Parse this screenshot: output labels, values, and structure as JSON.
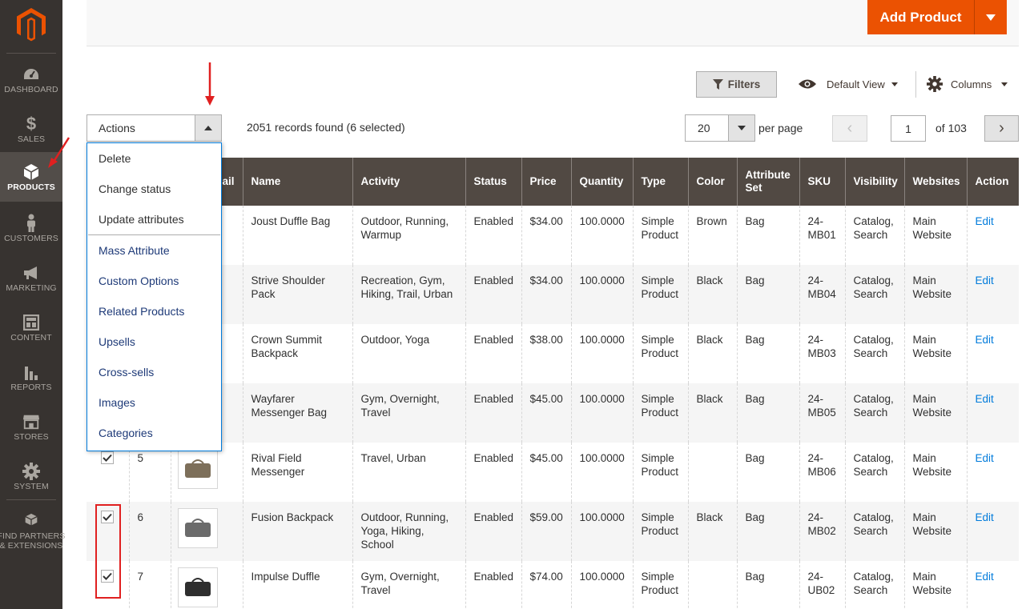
{
  "colors": {
    "sidebar_bg": "#373330",
    "sidebar_active": "#524d49",
    "accent": "#eb5202",
    "header_bg": "#514943",
    "link": "#007bdb",
    "annotation": "#e02020"
  },
  "sidebar": {
    "items": [
      {
        "label": "DASHBOARD",
        "icon": "dashboard-icon"
      },
      {
        "label": "SALES",
        "icon": "dollar-icon"
      },
      {
        "label": "PRODUCTS",
        "icon": "cube-icon",
        "active": true
      },
      {
        "label": "CUSTOMERS",
        "icon": "person-icon"
      },
      {
        "label": "MARKETING",
        "icon": "megaphone-icon"
      },
      {
        "label": "CONTENT",
        "icon": "layout-icon"
      },
      {
        "label": "REPORTS",
        "icon": "bar-chart-icon"
      },
      {
        "label": "STORES",
        "icon": "store-icon"
      },
      {
        "label": "SYSTEM",
        "icon": "gear-icon"
      },
      {
        "label_line1": "FIND PARTNERS",
        "label_line2": "& EXTENSIONS",
        "icon": "boxes-icon"
      }
    ]
  },
  "header": {
    "add_product_label": "Add Product"
  },
  "toolbar": {
    "filters_label": "Filters",
    "view_label": "Default View",
    "columns_label": "Columns"
  },
  "actions": {
    "label": "Actions",
    "records_text": "2051 records found (6 selected)",
    "menu_basic": [
      "Delete",
      "Change status",
      "Update attributes"
    ],
    "menu_extended": [
      "Mass Attribute",
      "Custom Options",
      "Related Products",
      "Upsells",
      "Cross-sells",
      "Images",
      "Categories"
    ]
  },
  "pager": {
    "per_page_value": "20",
    "per_page_label": "per page",
    "current_page": "1",
    "of_text": "of 103"
  },
  "grid": {
    "headers": [
      "",
      "",
      "ail",
      "Name",
      "Activity",
      "Status",
      "Price",
      "Quantity",
      "Type",
      "Color",
      "Attribute Set",
      "SKU",
      "Visibility",
      "Websites",
      "Action"
    ],
    "rows": [
      {
        "id": "",
        "name": "Joust Duffle Bag",
        "activity": "Outdoor, Running, Warmup",
        "status": "Enabled",
        "price": "$34.00",
        "qty": "100.0000",
        "type": "Simple Product",
        "color": "Brown",
        "attrset": "Bag",
        "sku": "24-MB01",
        "visibility": "Catalog, Search",
        "websites": "Main Website",
        "action": "Edit"
      },
      {
        "id": "",
        "name": "Strive Shoulder Pack",
        "activity": "Recreation, Gym, Hiking, Trail, Urban",
        "status": "Enabled",
        "price": "$34.00",
        "qty": "100.0000",
        "type": "Simple Product",
        "color": "Black",
        "attrset": "Bag",
        "sku": "24-MB04",
        "visibility": "Catalog, Search",
        "websites": "Main Website",
        "action": "Edit"
      },
      {
        "id": "",
        "name": "Crown Summit Backpack",
        "activity": "Outdoor, Yoga",
        "status": "Enabled",
        "price": "$38.00",
        "qty": "100.0000",
        "type": "Simple Product",
        "color": "Black",
        "attrset": "Bag",
        "sku": "24-MB03",
        "visibility": "Catalog, Search",
        "websites": "Main Website",
        "action": "Edit"
      },
      {
        "id": "",
        "name": "Wayfarer Messenger Bag",
        "activity": "Gym, Overnight, Travel",
        "status": "Enabled",
        "price": "$45.00",
        "qty": "100.0000",
        "type": "Simple Product",
        "color": "Black",
        "attrset": "Bag",
        "sku": "24-MB05",
        "visibility": "Catalog, Search",
        "websites": "Main Website",
        "action": "Edit"
      },
      {
        "id": "5",
        "name": "Rival Field Messenger",
        "activity": "Travel, Urban",
        "status": "Enabled",
        "price": "$45.00",
        "qty": "100.0000",
        "type": "Simple Product",
        "color": "",
        "attrset": "Bag",
        "sku": "24-MB06",
        "visibility": "Catalog, Search",
        "websites": "Main Website",
        "action": "Edit"
      },
      {
        "id": "6",
        "name": "Fusion Backpack",
        "activity": "Outdoor, Running, Yoga, Hiking, School",
        "status": "Enabled",
        "price": "$59.00",
        "qty": "100.0000",
        "type": "Simple Product",
        "color": "Black",
        "attrset": "Bag",
        "sku": "24-MB02",
        "visibility": "Catalog, Search",
        "websites": "Main Website",
        "action": "Edit"
      },
      {
        "id": "7",
        "name": "Impulse Duffle",
        "activity": "Gym, Overnight, Travel",
        "status": "Enabled",
        "price": "$74.00",
        "qty": "100.0000",
        "type": "Simple Product",
        "color": "",
        "attrset": "Bag",
        "sku": "24-UB02",
        "visibility": "Catalog, Search",
        "websites": "Main Website",
        "action": "Edit"
      }
    ]
  }
}
